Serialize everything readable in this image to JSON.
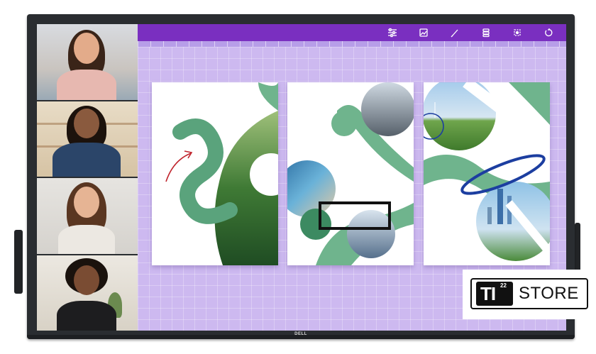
{
  "device": {
    "brand_logo": "DELL"
  },
  "toolbar": {
    "icons": [
      "sliders-icon",
      "image-icon",
      "pen-icon",
      "layers-icon",
      "select-icon",
      "undo-icon"
    ]
  },
  "video_call": {
    "participants": [
      "participant-1",
      "participant-2",
      "participant-3",
      "participant-4"
    ]
  },
  "whiteboard": {
    "cards": [
      "forest-card",
      "coast-card",
      "city-card"
    ]
  },
  "store_badge": {
    "logo_text": "TI",
    "logo_sup": "22",
    "store_text": "STORE"
  },
  "colors": {
    "toolbar": "#7a2fc0",
    "canvas": "#cdb9f0",
    "accent_green": "#5aa37c",
    "ink_red": "#c0242d",
    "ink_blue": "#1c3ea0"
  }
}
